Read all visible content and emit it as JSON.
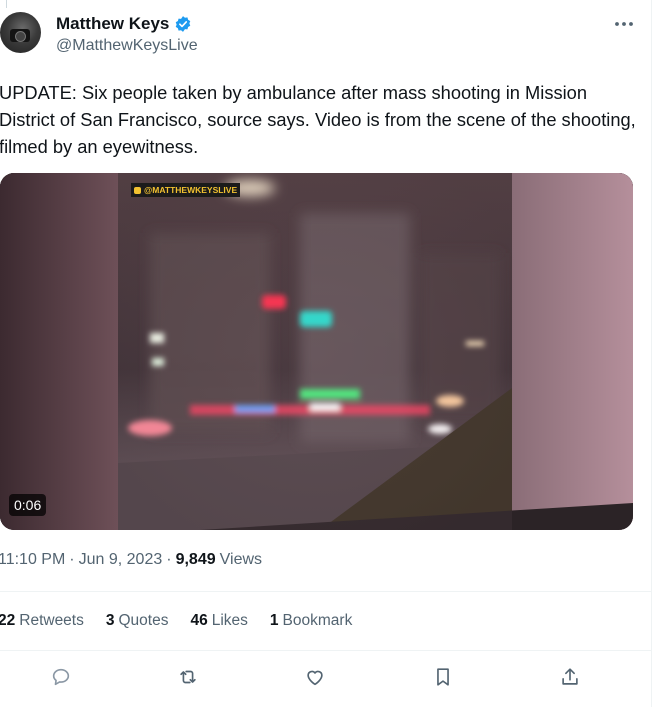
{
  "author": {
    "display_name": "Matthew Keys",
    "handle": "@MatthewKeysLive",
    "verified": true,
    "avatar_icon": "photographer-avatar"
  },
  "tweet": {
    "text": "UPDATE: Six people taken by ambulance after mass shooting in Mission District of San Francisco, source says. Video is from the scene of the shooting, filmed by an eyewitness."
  },
  "media": {
    "type": "video",
    "watermark": "@MATTHEWKEYSLIVE",
    "duration": "0:06"
  },
  "meta": {
    "time": "11:10 PM",
    "date": "Jun 9, 2023",
    "views_count": "9,849",
    "views_label": "Views",
    "separator": "·"
  },
  "stats": {
    "retweets_count": "22",
    "retweets_label": "Retweets",
    "quotes_count": "3",
    "quotes_label": "Quotes",
    "likes_count": "46",
    "likes_label": "Likes",
    "bookmarks_count": "1",
    "bookmarks_label": "Bookmark"
  },
  "actions": [
    "reply-icon",
    "retweet-icon",
    "like-icon",
    "bookmark-icon",
    "share-icon"
  ],
  "colors": {
    "text": "#0f1419",
    "secondary": "#536471",
    "verified": "#1d9bf0",
    "divider": "#eff3f4",
    "watermark": "#f2c230"
  }
}
